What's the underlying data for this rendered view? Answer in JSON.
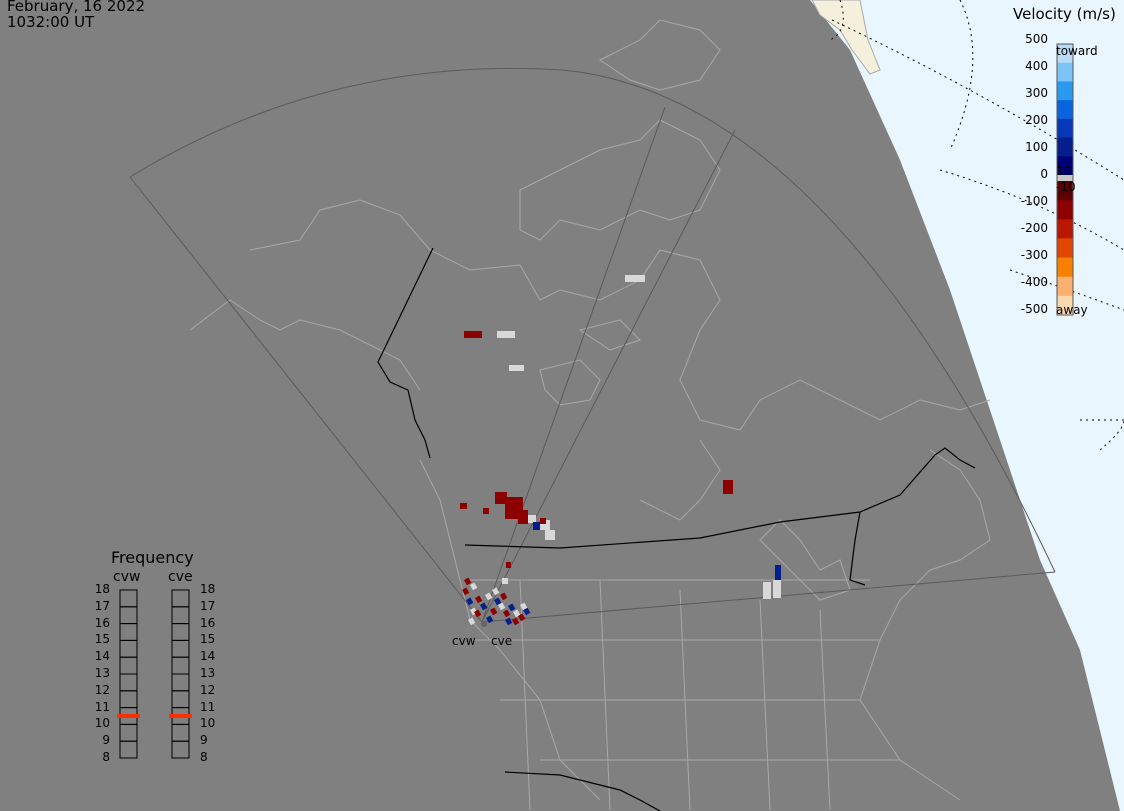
{
  "header": {
    "date": "February, 16 2022",
    "time": "1032:00 UT"
  },
  "velocity_scale": {
    "title": "Velocity (m/s)",
    "ticks": [
      "500",
      "400",
      "300",
      "200",
      "100",
      "0",
      "-100",
      "-200",
      "-300",
      "-400",
      "-500"
    ],
    "toward_label": "toward",
    "away_label": "away",
    "threshold_pos": "10",
    "threshold_neg": "-10",
    "colors": [
      "#b8dcf6",
      "#7cc4f6",
      "#2a9af0",
      "#0a64e0",
      "#0838b8",
      "#041e8c",
      "#000078",
      "#5a0000",
      "#8c0000",
      "#b81800",
      "#e04800",
      "#f88000",
      "#fab070",
      "#fad8b0"
    ]
  },
  "frequency_panel": {
    "title": "Frequency",
    "columns": [
      {
        "name": "cvw",
        "active_value": 11
      },
      {
        "name": "cve",
        "active_value": 11
      }
    ],
    "ticks": [
      "18",
      "17",
      "16",
      "15",
      "14",
      "13",
      "12",
      "11",
      "10",
      "9",
      "8"
    ],
    "indicator_color": "#ff3000"
  },
  "radars": [
    {
      "name": "cvw"
    },
    {
      "name": "cve"
    }
  ],
  "colors": {
    "background": "#808080",
    "map_lines": "#a8a8a8",
    "borders": "#000000",
    "sunlit_region": "#eaf6fe"
  }
}
